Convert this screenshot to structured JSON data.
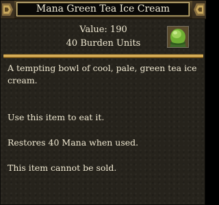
{
  "tooltip": {
    "title": "Mana Green Tea Ice Cream",
    "value_text": "Value: 190",
    "burden_text": "40 Burden Units",
    "icon": "green-tea-ice-cream-icon",
    "description": "A tempting bowl of cool, pale, green tea ice cream.",
    "usage": "Use this item to eat it.",
    "effect": "Restores 40 Mana when used.",
    "sell_note": "This item cannot be sold."
  },
  "colors": {
    "text": "#f0e9d2",
    "divider_gold": "#e6b75a",
    "title_border": "#d6c48a",
    "ice_cream_green": "#7cc23a"
  }
}
